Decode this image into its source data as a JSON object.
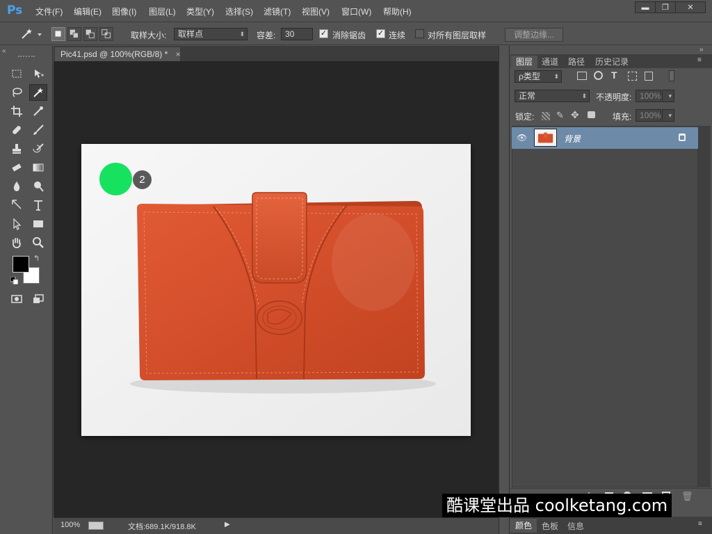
{
  "app": {
    "logo": "Ps",
    "menu": [
      "文件(F)",
      "编辑(E)",
      "图像(I)",
      "图层(L)",
      "类型(Y)",
      "选择(S)",
      "滤镜(T)",
      "视图(V)",
      "窗口(W)",
      "帮助(H)"
    ],
    "window_buttons": {
      "minimize": "▬",
      "restore": "❐",
      "close": "✕"
    }
  },
  "options": {
    "sample_size_label": "取样大小:",
    "sample_size_value": "取样点",
    "tolerance_label": "容差:",
    "tolerance_value": "30",
    "antialias_label": "消除锯齿",
    "antialias_checked": true,
    "contiguous_label": "连续",
    "contiguous_checked": true,
    "sample_all_label": "对所有图层取样",
    "sample_all_checked": false,
    "refine_edge_label": "调整边缘..."
  },
  "document": {
    "tab_title": "Pic41.psd @ 100%(RGB/8) *",
    "tab_close": "×",
    "zoom": "100%",
    "doc_info": "文档:689.1K/918.8K",
    "step_number": "2",
    "marker_color": "#16e25f"
  },
  "panels": {
    "tabs": [
      "图层",
      "通道",
      "路径",
      "历史记录"
    ],
    "filter_kind": "ρ类型",
    "blend_mode": "正常",
    "opacity_label": "不透明度:",
    "opacity_value": "100%",
    "lock_label": "锁定:",
    "fill_label": "填充:",
    "fill_value": "100%",
    "layers": [
      {
        "name": "背景",
        "visible": true,
        "locked": true
      }
    ],
    "bottom_tabs": [
      "颜色",
      "色板",
      "信息"
    ]
  },
  "watermark": "酷课堂出品 coolketang.com",
  "colors": {
    "accent": "#4aa3f0",
    "selected_layer": "#6d8aa8",
    "wallet": "#d9522e"
  }
}
